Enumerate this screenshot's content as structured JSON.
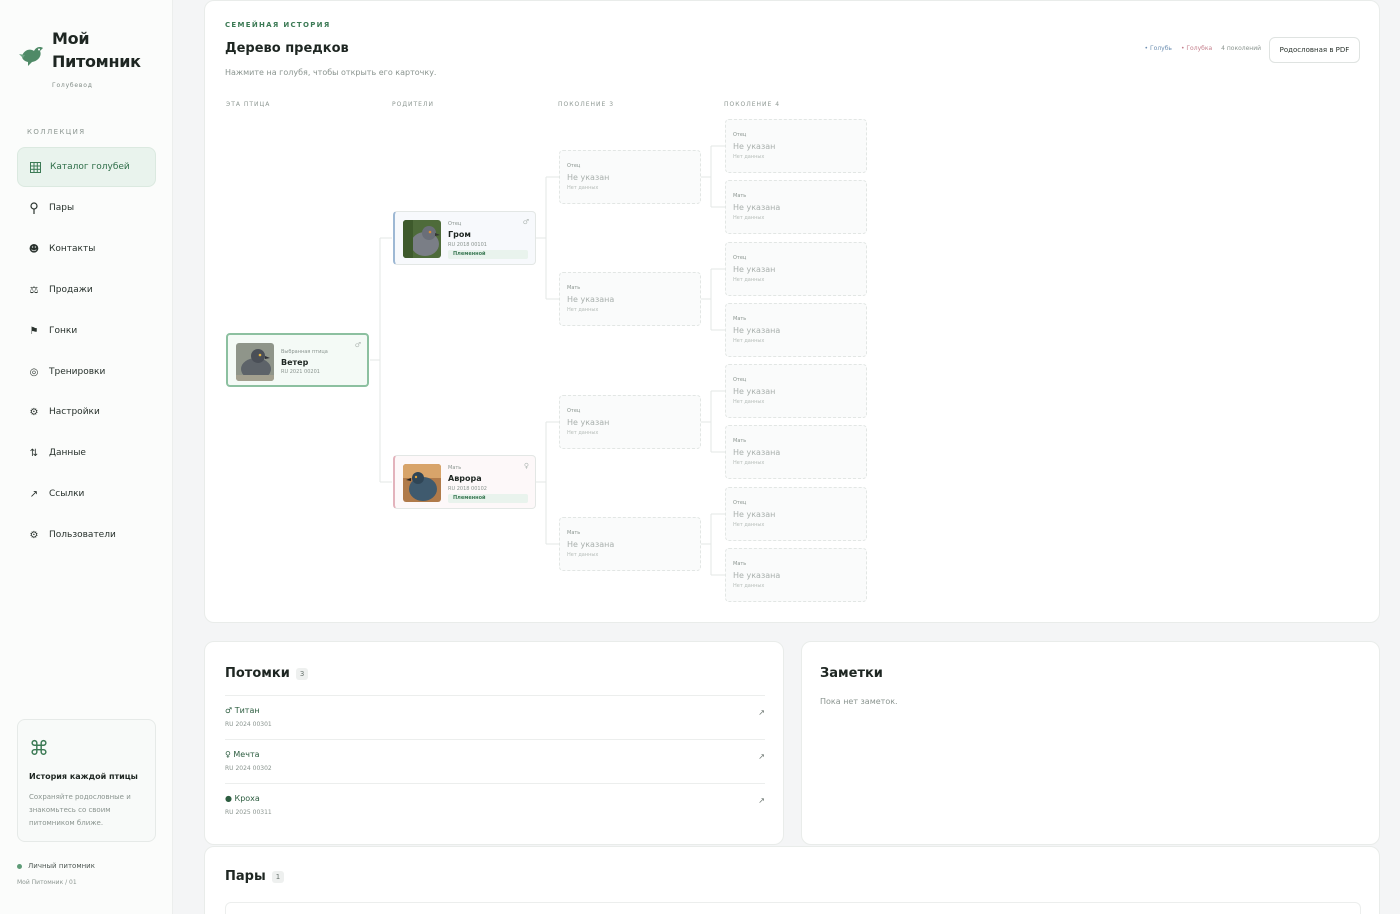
{
  "brand": {
    "title": "Мой Питомник",
    "subtitle": "Голубевод"
  },
  "sidebar": {
    "section": "КОЛЛЕКЦИЯ",
    "items": [
      {
        "label": "Каталог голубей",
        "icon": "grid-icon",
        "active": true
      },
      {
        "label": "Пары",
        "icon": "pin-icon"
      },
      {
        "label": "Контакты",
        "icon": "contact-icon"
      },
      {
        "label": "Продажи",
        "icon": "scales-icon"
      },
      {
        "label": "Гонки",
        "icon": "flag-icon"
      },
      {
        "label": "Тренировки",
        "icon": "target-icon"
      },
      {
        "label": "Настройки",
        "icon": "settings-icon"
      },
      {
        "label": "Данные",
        "icon": "sort-icon"
      },
      {
        "label": "Ссылки",
        "icon": "link-arrow-icon"
      },
      {
        "label": "Пользователи",
        "icon": "users-icon"
      }
    ],
    "promo": {
      "icon": "command-icon",
      "title": "История каждой птицы",
      "text": "Сохраняйте родословные и знакомьтесь со своим питомником ближе."
    },
    "footer": {
      "line1": "Личный питомник",
      "line2": "Мой Питомник / 01"
    }
  },
  "tree": {
    "eyebrow": "СЕМЕЙНАЯ ИСТОРИЯ",
    "title": "Дерево предков",
    "hint": "Нажмите на голубя, чтобы открыть его карточку.",
    "legend": {
      "male": "• Голубь",
      "female": "• Голубка",
      "generations": "4 поколений"
    },
    "pdf_button": "Родословная в PDF",
    "columns": [
      "ЭТА ПТИЦА",
      "РОДИТЕЛИ",
      "ПОКОЛЕНИЕ 3",
      "ПОКОЛЕНИЕ 4"
    ],
    "self": {
      "role": "Выбранная птица",
      "name": "Ветер",
      "ring": "RU 2021 00201",
      "sex": "♂"
    },
    "father": {
      "role": "Отец",
      "name": "Гром",
      "ring": "RU 2018 00101",
      "tag": "Племенной",
      "sex": "♂"
    },
    "mother": {
      "role": "Мать",
      "name": "Аврора",
      "ring": "RU 2018 00102",
      "tag": "Племенной",
      "sex": "♀"
    },
    "unknown": {
      "father_role": "Отец",
      "mother_role": "Мать",
      "father_name": "Не указан",
      "mother_name": "Не указана",
      "no_data": "Нет данных"
    }
  },
  "offspring": {
    "title": "Потомки",
    "count": "3",
    "items": [
      {
        "name": "♂ Титан",
        "ring": "RU 2024 00301",
        "arrow": "↗"
      },
      {
        "name": "♀ Мечта",
        "ring": "RU 2024 00302",
        "arrow": "↗"
      },
      {
        "name": "● Кроха",
        "ring": "RU 2025 00311",
        "arrow": "↗"
      }
    ]
  },
  "notes": {
    "title": "Заметки",
    "empty": "Пока нет заметок."
  },
  "pairs": {
    "title": "Пары",
    "count": "1"
  },
  "colors": {
    "accent": "#3c7a55",
    "male": "#9db8d4",
    "female": "#e3b3bc"
  }
}
